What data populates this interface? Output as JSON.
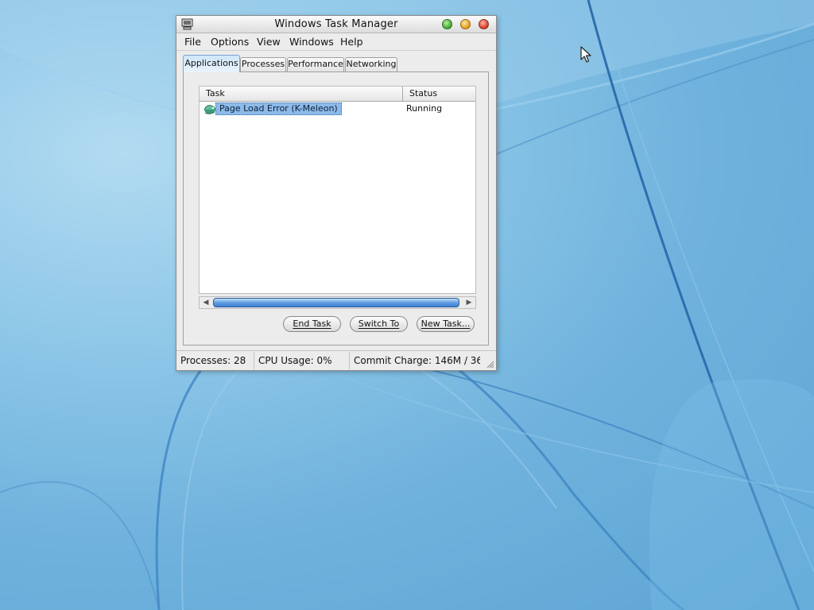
{
  "window": {
    "title": "Windows Task Manager"
  },
  "menu": {
    "items": [
      "File",
      "Options",
      "View",
      "Windows",
      "Help"
    ]
  },
  "tabs": [
    {
      "label": "Applications",
      "active": true
    },
    {
      "label": "Processes",
      "active": false
    },
    {
      "label": "Performance",
      "active": false
    },
    {
      "label": "Networking",
      "active": false
    }
  ],
  "task_list": {
    "columns": [
      "Task",
      "Status"
    ],
    "rows": [
      {
        "task": "Page Load Error (K-Meleon)",
        "status": "Running",
        "icon": "k-meleon-icon",
        "selected": true
      }
    ]
  },
  "buttons": {
    "end_task": "End Task",
    "switch_to": "Switch To",
    "new_task": "New Task..."
  },
  "status_bar": {
    "processes": "Processes: 28",
    "cpu_usage": "CPU Usage: 0%",
    "commit_charge": "Commit Charge: 146M / 36"
  },
  "colors": {
    "selection": "#8dbbe9",
    "active_tab": "#cfe6fb",
    "scroll_thumb": "#5c9ae2",
    "desktop": "#6fb2dd"
  }
}
